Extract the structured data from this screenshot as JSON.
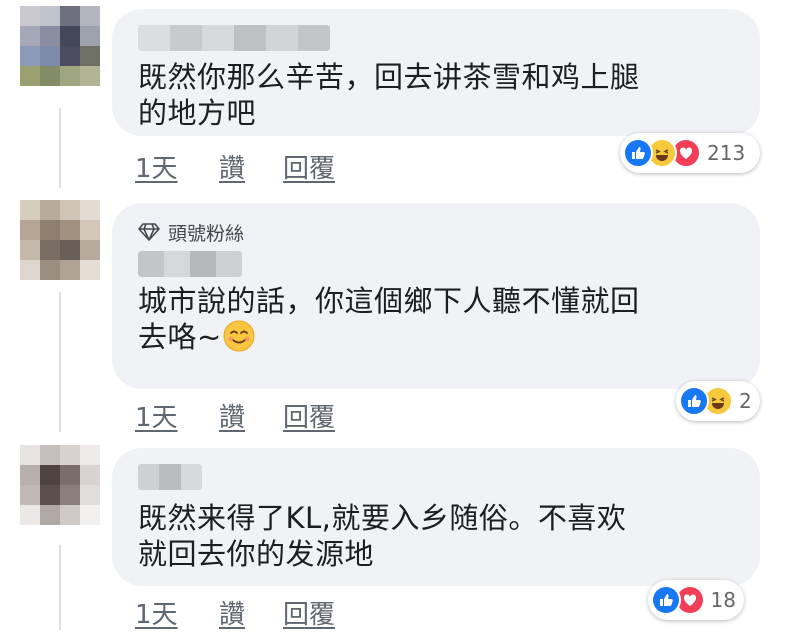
{
  "comments": [
    {
      "text_line1": "既然你那么辛苦，回去讲茶雪和鸡上腿",
      "text_line2": "的地方吧",
      "time": "1天",
      "like": "讚",
      "reply": "回覆",
      "reaction_count": "213",
      "reactions": [
        "like-icon",
        "haha-icon",
        "love-icon"
      ]
    },
    {
      "badge": "頭號粉絲",
      "text_line1": "城市說的話，你這個鄉下人聽不懂就回",
      "text_line2": "去咯~",
      "time": "1天",
      "like": "讚",
      "reply": "回覆",
      "reaction_count": "2",
      "reactions": [
        "like-icon",
        "haha-icon"
      ]
    },
    {
      "text_line1": "既然来得了KL,就要入乡随俗。不喜欢",
      "text_line2": "就回去你的发源地",
      "time": "1天",
      "like": "讚",
      "reply": "回覆",
      "reaction_count": "18",
      "reactions": [
        "like-icon",
        "love-icon"
      ]
    }
  ],
  "colors": {
    "bubble_bg": "#f0f2f5",
    "like_blue": "#1877f2",
    "love_red": "#f33e58",
    "haha_yellow": "#f7c93c",
    "meta_gray": "#606770"
  }
}
